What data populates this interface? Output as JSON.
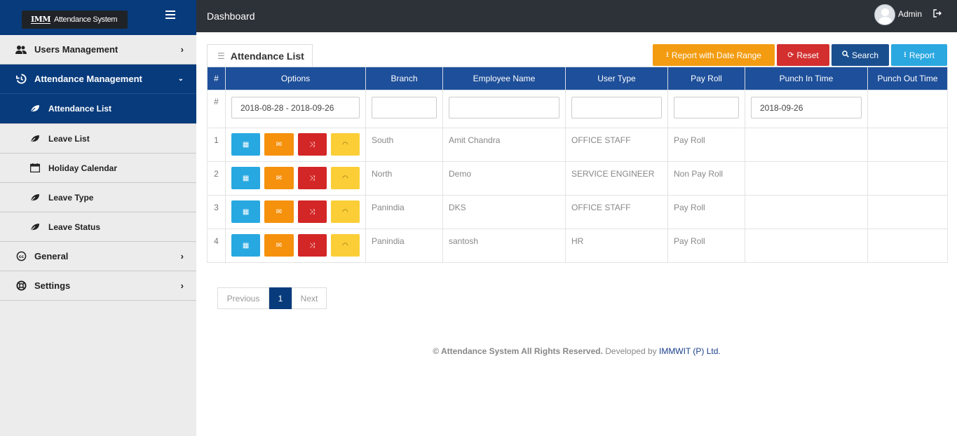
{
  "app": {
    "logo_mark": "IMM",
    "logo_text": "Attendance System"
  },
  "topbar": {
    "title": "Dashboard",
    "user": "Admin"
  },
  "sidebar": {
    "items": [
      {
        "label": "Users Management",
        "icon": "users-icon"
      },
      {
        "label": "Attendance Management",
        "icon": "history-icon"
      },
      {
        "label": "General",
        "icon": "cc-icon"
      },
      {
        "label": "Settings",
        "icon": "lifebuoy-icon"
      }
    ],
    "sub_items": [
      {
        "label": "Attendance List",
        "icon": "leaf-icon"
      },
      {
        "label": "Leave List",
        "icon": "leaf-icon"
      },
      {
        "label": "Holiday Calendar",
        "icon": "calendar-icon"
      },
      {
        "label": "Leave Type",
        "icon": "leaf-icon"
      },
      {
        "label": "Leave Status",
        "icon": "leaf-icon"
      }
    ]
  },
  "panel": {
    "title": "Attendance List"
  },
  "actions": {
    "range": "Report with Date Range",
    "reset": "Reset",
    "search": "Search",
    "report": "Report"
  },
  "table": {
    "headers": [
      "#",
      "Options",
      "Branch",
      "Employee Name",
      "User Type",
      "Pay Roll",
      "Punch In Time",
      "Punch Out Time"
    ],
    "filters": {
      "hash": "#",
      "options": "2018-08-28 - 2018-09-26",
      "punch_in": "2018-09-26"
    },
    "rows": [
      {
        "num": "1",
        "branch": "South",
        "name": "Amit Chandra",
        "type": "OFFICE STAFF",
        "payroll": "Pay Roll"
      },
      {
        "num": "2",
        "branch": "North",
        "name": "Demo",
        "type": "SERVICE ENGINEER",
        "payroll": "Non Pay Roll"
      },
      {
        "num": "3",
        "branch": "Panindia",
        "name": "DKS",
        "type": "OFFICE STAFF",
        "payroll": "Pay Roll"
      },
      {
        "num": "4",
        "branch": "Panindia",
        "name": "santosh",
        "type": "HR",
        "payroll": "Pay Roll"
      }
    ]
  },
  "pager": {
    "prev": "Previous",
    "current": "1",
    "next": "Next"
  },
  "footer": {
    "rights": "© Attendance System All Rights Reserved.",
    "dev": " Developed by ",
    "company": "IMMWIT (P) Ltd."
  }
}
